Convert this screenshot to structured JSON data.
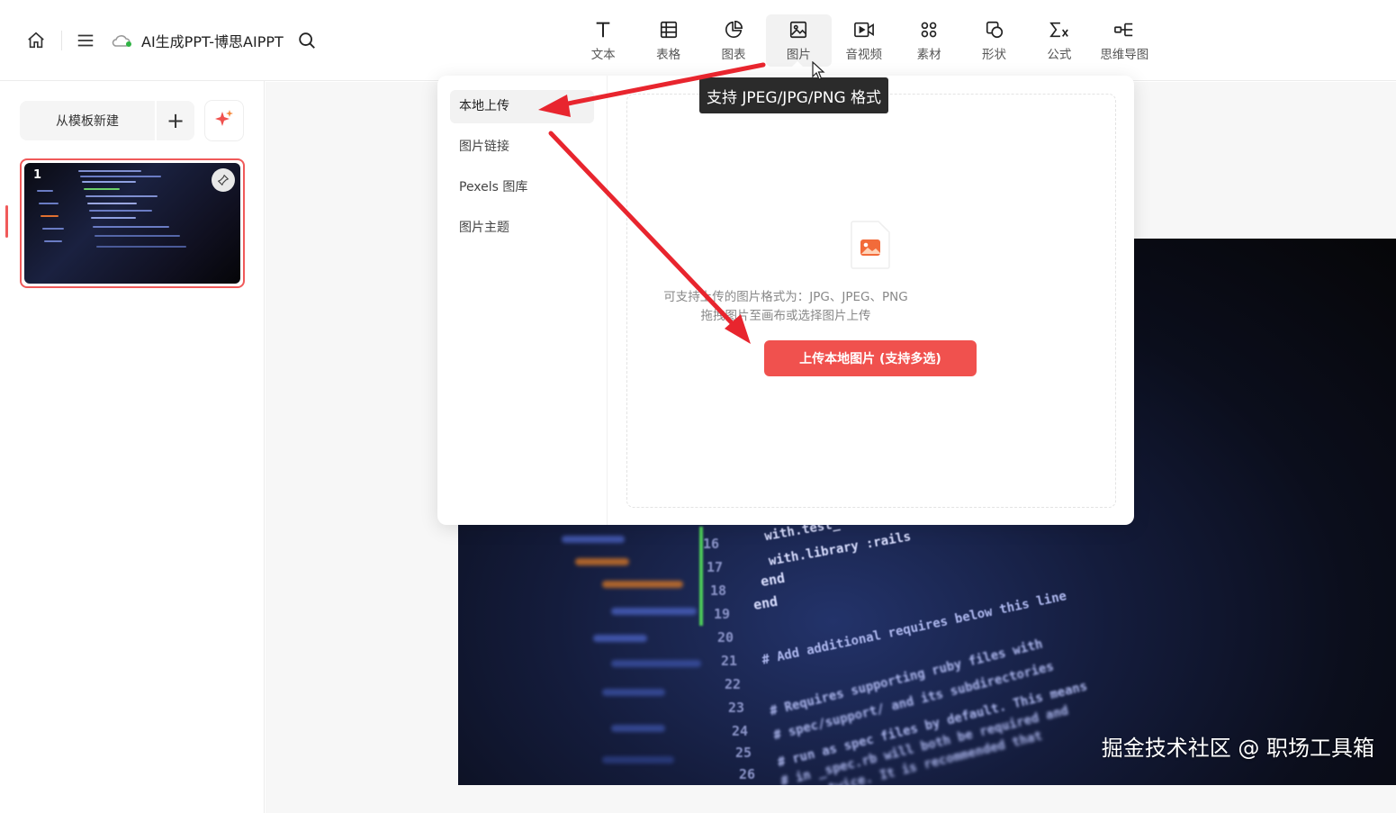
{
  "header": {
    "title": "AI生成PPT-博思AIPPT",
    "tools": [
      {
        "label": "文本",
        "icon": "text-icon"
      },
      {
        "label": "表格",
        "icon": "table-icon"
      },
      {
        "label": "图表",
        "icon": "chart-icon"
      },
      {
        "label": "图片",
        "icon": "image-icon",
        "active": true
      },
      {
        "label": "音视频",
        "icon": "media-icon"
      },
      {
        "label": "素材",
        "icon": "material-icon"
      },
      {
        "label": "形状",
        "icon": "shape-icon"
      },
      {
        "label": "公式",
        "icon": "formula-icon"
      },
      {
        "label": "思维导图",
        "icon": "mindmap-icon"
      }
    ]
  },
  "sidebar": {
    "new_from_template": "从模板新建",
    "slides": [
      {
        "number": "1"
      }
    ]
  },
  "image_panel": {
    "nav": [
      {
        "label": "本地上传",
        "active": true
      },
      {
        "label": "图片链接"
      },
      {
        "label": "Pexels 图库"
      },
      {
        "label": "图片主题"
      }
    ],
    "hint_line1": "可支持上传的图片格式为：JPG、JPEG、PNG",
    "hint_line2": "拖拽图片至画布或选择图片上传",
    "upload_button": "上传本地图片 (支持多选)"
  },
  "tooltip": "支持 JPEG/JPG/PNG 格式",
  "slide": {
    "code_lines": [
      "with.test_",
      "with.library :rails",
      "end",
      "end",
      "# Add additional requires below this line",
      "# Requires supporting ruby files with",
      "# spec/support/ and its subdirectories",
      "# run as spec files by default. This means",
      "# in _spec.rb will both be required and",
      "# run twice. It is recommended that"
    ],
    "line_numbers": [
      "16",
      "17",
      "18",
      "19",
      "20",
      "21",
      "22",
      "23",
      "24",
      "25",
      "26"
    ]
  },
  "watermark": "掘金技术社区 @ 职场工具箱",
  "colors": {
    "accent": "#f0514e",
    "annotation_arrow": "#e8252e",
    "status_dot": "#2fb344"
  }
}
